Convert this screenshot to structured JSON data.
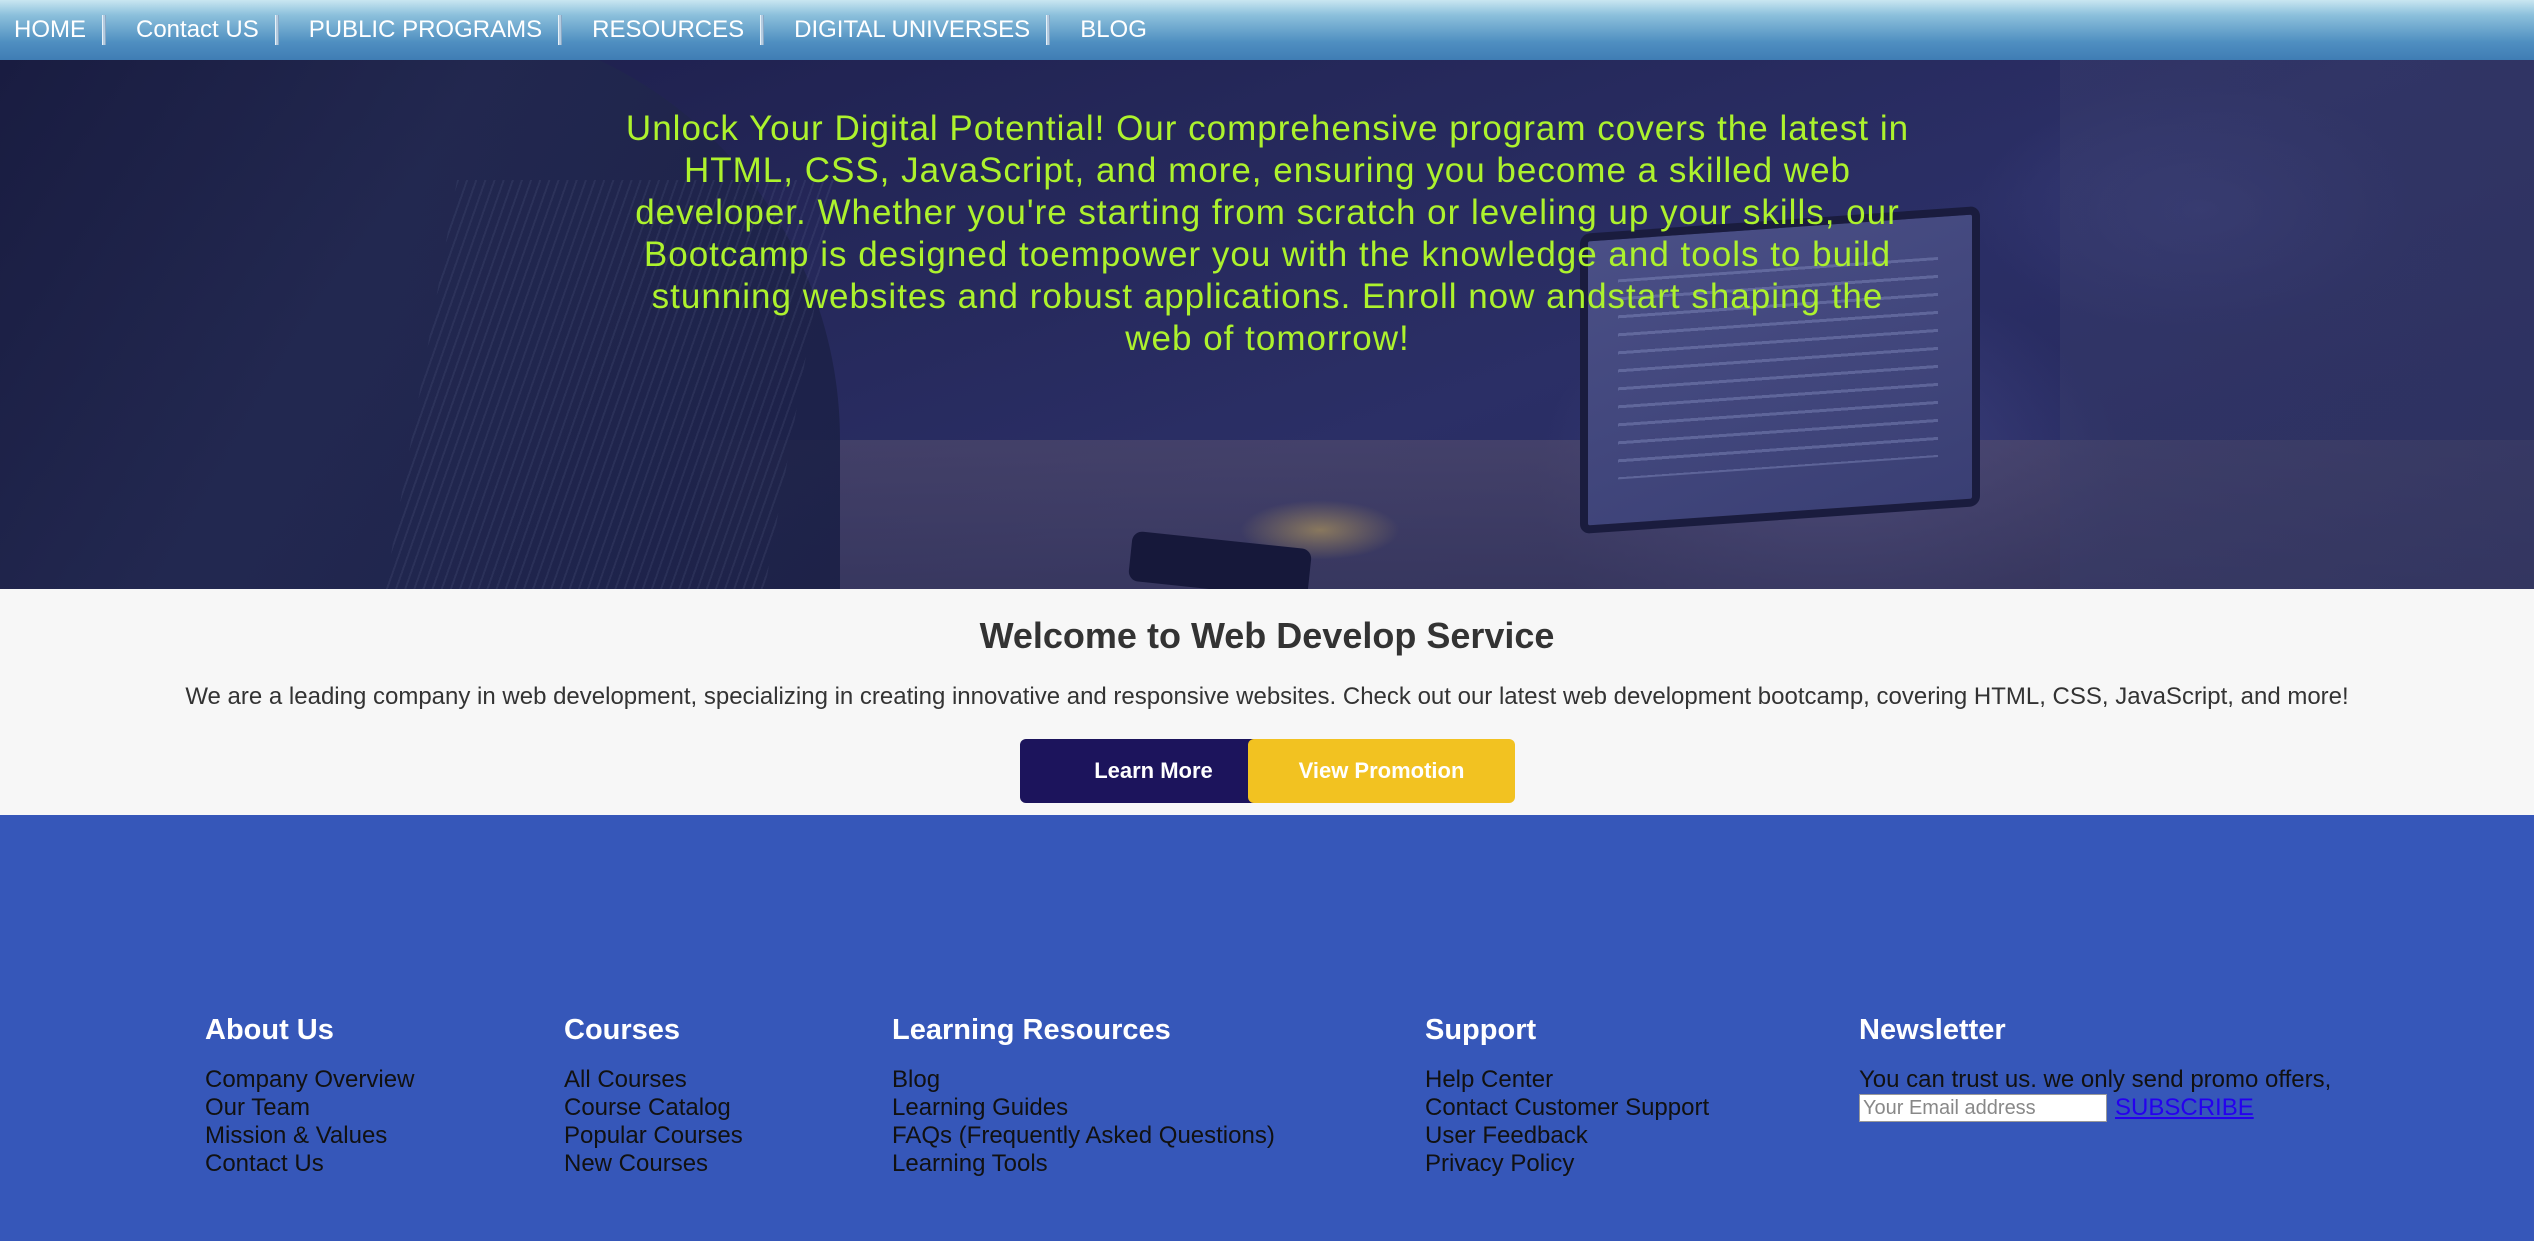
{
  "nav": {
    "items": [
      "HOME",
      "Contact US",
      "PUBLIC PROGRAMS",
      "RESOURCES",
      "DIGITAL UNIVERSES",
      "BLOG"
    ]
  },
  "hero": {
    "text": "Unlock Your Digital Potential! Our comprehensive program covers the latest in HTML, CSS, JavaScript, and more, ensuring you become a skilled web developer. Whether you're starting from scratch or leveling up your skills, our Bootcamp is designed toempower you with the knowledge and tools to build stunning websites and robust applications. Enroll now andstart shaping the web of tomorrow!",
    "text_color": "#adf22d"
  },
  "welcome": {
    "title": "Welcome to Web Develop Service",
    "description": "We are a leading company in web development, specializing in creating innovative and responsive websites. Check out our latest web development bootcamp, covering HTML, CSS, JavaScript, and more!",
    "learn_more_label": "Learn More",
    "promotion_label": "View Promotion",
    "learn_more_color": "#1c145c",
    "promotion_color": "#f2c221"
  },
  "footer": {
    "background": "#3657b9",
    "about": {
      "title": "About Us",
      "links": [
        "Company Overview",
        "Our Team",
        "Mission & Values",
        "Contact Us"
      ]
    },
    "courses": {
      "title": "Courses",
      "links": [
        "All Courses",
        "Course Catalog",
        "Popular Courses",
        "New Courses"
      ]
    },
    "learning": {
      "title": "Learning Resources",
      "links": [
        "Blog",
        "Learning Guides",
        "FAQs (Frequently Asked Questions)",
        "Learning Tools"
      ]
    },
    "support": {
      "title": "Support",
      "links": [
        "Help Center",
        "Contact Customer Support",
        "User Feedback",
        "Privacy Policy"
      ]
    },
    "newsletter": {
      "title": "Newsletter",
      "text": "You can trust us. we only send promo offers,",
      "email_placeholder": "Your Email address",
      "email_value": "",
      "subscribe_label": "SUBSCRIBE"
    }
  }
}
